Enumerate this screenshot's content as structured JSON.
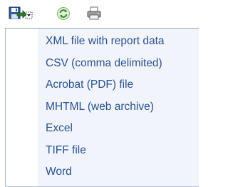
{
  "toolbar": {
    "export_icon": "export-disk-icon",
    "refresh_icon": "refresh-icon",
    "print_icon": "printer-icon"
  },
  "export_menu": {
    "items": [
      {
        "label": "XML file with report data"
      },
      {
        "label": "CSV (comma delimited)"
      },
      {
        "label": "Acrobat (PDF) file"
      },
      {
        "label": "MHTML (web archive)"
      },
      {
        "label": "Excel"
      },
      {
        "label": "TIFF file"
      },
      {
        "label": "Word"
      }
    ]
  },
  "colors": {
    "menu_text": "#29538f",
    "menu_bg": "#f1f4fb",
    "menu_border": "#9aa7bd"
  }
}
